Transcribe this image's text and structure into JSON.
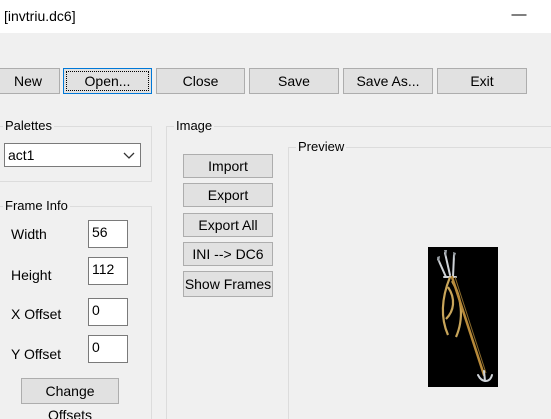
{
  "window": {
    "title": "[invtriu.dc6]",
    "minimize_glyph": "—"
  },
  "toolbar": {
    "new_label": "New",
    "open_label": "Open...",
    "close_label": "Close",
    "save_label": "Save",
    "save_as_label": "Save As...",
    "exit_label": "Exit"
  },
  "palettes": {
    "group_label": "Palettes",
    "selected": "act1",
    "chevron_icon": "chevron-down-icon"
  },
  "frame_info": {
    "group_label": "Frame Info",
    "width_label": "Width",
    "width_value": "56",
    "height_label": "Height",
    "height_value": "112",
    "x_offset_label": "X Offset",
    "x_offset_value": "0",
    "y_offset_label": "Y Offset",
    "y_offset_value": "0",
    "change_offsets_label": "Change Offsets"
  },
  "image": {
    "group_label": "Image",
    "import_label": "Import",
    "export_label": "Export",
    "export_all_label": "Export All",
    "ini_dc6_label": "INI --> DC6",
    "show_frames_label": "Show Frames"
  },
  "preview": {
    "group_label": "Preview",
    "image_icon": "trident-sprite-icon"
  },
  "colors": {
    "window_bg": "#f0f0f0",
    "button_bg": "#e1e1e1",
    "focus_border": "#0078d7",
    "preview_bg": "#000000"
  }
}
